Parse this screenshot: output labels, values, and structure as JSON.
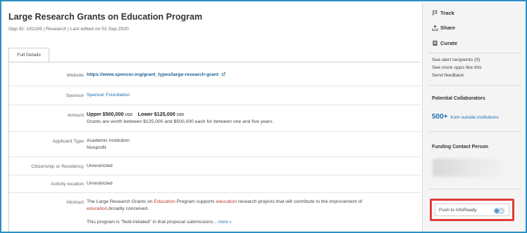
{
  "opp": {
    "title": "Large Research Grants on Education Program",
    "meta": "Opp ID: 191156  |  Research  |  Last edited on 01 Sep 2020"
  },
  "tabs": [
    {
      "label": "Full Details"
    }
  ],
  "details": {
    "website": {
      "label": "Website",
      "value": "https://www.spencer.org/grant_types/large-research-grant"
    },
    "sponsor": {
      "label": "Sponsor",
      "value": "Spencer Foundation"
    },
    "amount": {
      "label": "Amount",
      "upper_label": "Upper",
      "upper_value": "$500,000",
      "lower_label": "Lower",
      "lower_value": "$125,000",
      "currency": "USD",
      "note": "Grants are worth between $125,000 and $500,000 each for between one and five years."
    },
    "applicant_type": {
      "label": "Applicant Type",
      "values": [
        "Academic Institution",
        "Nonprofit"
      ]
    },
    "citizenship": {
      "label": "Citizenship or Residency",
      "value": "Unrestricted"
    },
    "activity_location": {
      "label": "Activity location",
      "value": "Unrestricted"
    },
    "abstract": {
      "label": "Abstract",
      "p1": "The Large Research Grants on ",
      "p2": "Education",
      "p3": " Program supports ",
      "p4": "education",
      "p5": " research projects that will contribute to the improvement of",
      "p6": "education",
      "p7": ",broadly conceived.",
      "p8": "This program is \"field-initiated\" in that proposal submissions...",
      "more": "more »"
    }
  },
  "sidebar": {
    "actions": [
      {
        "label": "Track",
        "icon": "flag-icon"
      },
      {
        "label": "Share",
        "icon": "share-icon"
      },
      {
        "label": "Curate",
        "icon": "curate-icon"
      }
    ],
    "links": [
      "See alert recipients  (0)",
      "See more opps like this",
      "Send feedback"
    ],
    "collaborators_heading": "Potential Collaborators",
    "collaborators_count": "500+",
    "collaborators_text": "from outside institutions",
    "funding_contact_heading": "Funding Contact Person",
    "push_label": "Push to InfoReady"
  },
  "colors": {
    "frame_border": "#2d8fc4",
    "link": "#1a6fae",
    "highlight": "#c0392b",
    "push_border": "#e23a3a"
  }
}
